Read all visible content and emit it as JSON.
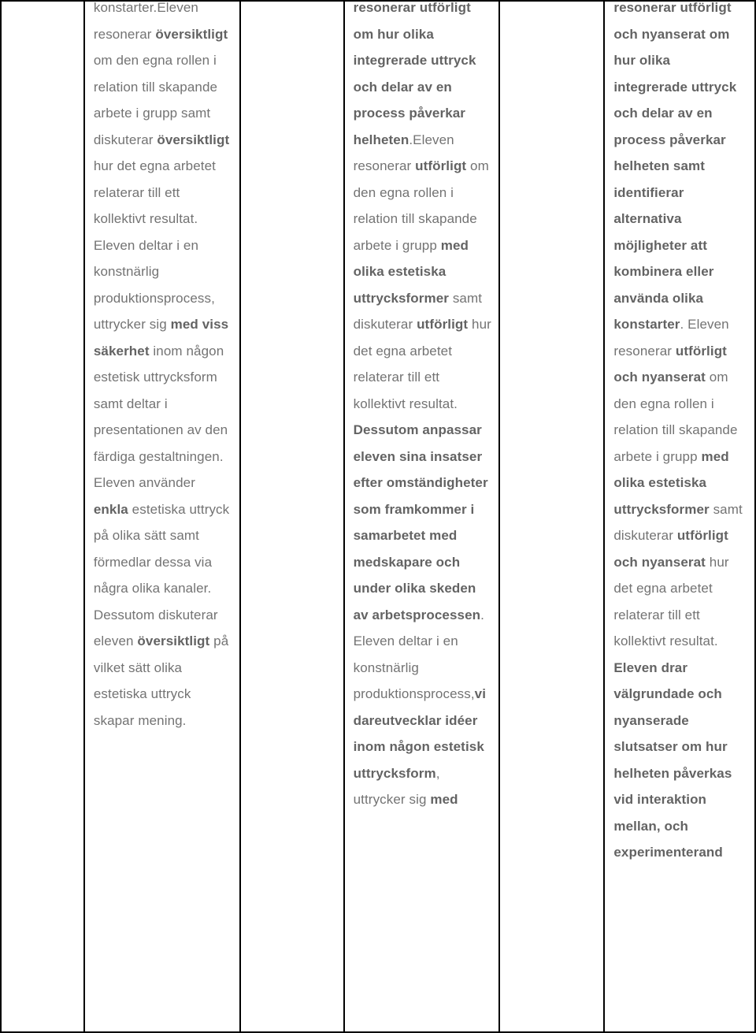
{
  "document": {
    "type": "grading-criteria-table",
    "language": "sv",
    "columns": 5,
    "text_color": "#737373",
    "bold_color": "#636363",
    "border_color": "#000000"
  },
  "table": {
    "row": {
      "pad_left_cell": "",
      "gap_cell_1": "",
      "gap_cell_2": "",
      "cells": [
        {
          "id": "criteria-column-e",
          "runs": [
            {
              "text": "konstarter.",
              "bold": false
            },
            {
              "text": "Eleven resonerar ",
              "bold": false
            },
            {
              "text": "översiktligt",
              "bold": true
            },
            {
              "text": " om den egna rollen i relation till skapande arbete i grupp samt diskuterar ",
              "bold": false
            },
            {
              "text": "översiktligt",
              "bold": true
            },
            {
              "text": " hur det egna arbetet relaterar till ett kollektivt resultat. Eleven deltar i en konstnärlig produktionsprocess, uttrycker sig ",
              "bold": false
            },
            {
              "text": "med viss säkerhet",
              "bold": true
            },
            {
              "text": " inom någon estetisk uttrycksform samt deltar i presentationen av den färdiga gestaltningen. Eleven använder ",
              "bold": false
            },
            {
              "text": "enkla",
              "bold": true
            },
            {
              "text": " estetiska uttryck på olika sätt samt förmedlar dessa via några olika kanaler. Dessutom diskuterar eleven ",
              "bold": false
            },
            {
              "text": "översiktligt",
              "bold": true
            },
            {
              "text": " på vilket sätt olika estetiska uttryck skapar mening.",
              "bold": false
            }
          ]
        },
        {
          "id": "criteria-column-c",
          "runs": [
            {
              "text": "resonerar utförligt om hur olika integrerade uttryck och delar av en process påverkar helheten",
              "bold": true
            },
            {
              "text": ".",
              "bold": false
            },
            {
              "text": "Eleven resonerar ",
              "bold": false
            },
            {
              "text": "utförligt",
              "bold": true
            },
            {
              "text": " om den egna rollen i relation till skapande arbete i grupp ",
              "bold": false
            },
            {
              "text": "med olika estetiska uttrycksformer",
              "bold": true
            },
            {
              "text": " samt diskuterar ",
              "bold": false
            },
            {
              "text": "utförligt",
              "bold": true
            },
            {
              "text": " hur det egna arbetet relaterar till ett kollektivt resultat. ",
              "bold": false
            },
            {
              "text": "Dessutom anpassar eleven sina insatser efter omständigheter som framkommer i samarbetet med medskapare och under olika skeden av arbetsprocessen",
              "bold": true
            },
            {
              "text": ". Eleven deltar i en konstnärlig produktionsprocess,",
              "bold": false
            },
            {
              "text": "vidareutvecklar idéer inom någon estetisk uttrycksform",
              "bold": true
            },
            {
              "text": ", uttrycker sig ",
              "bold": false
            },
            {
              "text": "med",
              "bold": true
            }
          ]
        },
        {
          "id": "criteria-column-a",
          "runs": [
            {
              "text": "resonerar utförligt och nyanserat om hur olika integrerade uttryck och delar av en process påverkar helheten samt identifierar alternativa möjligheter att kombinera eller använda olika konstarter",
              "bold": true
            },
            {
              "text": ". Eleven resonerar ",
              "bold": false
            },
            {
              "text": "utförligt och nyanserat",
              "bold": true
            },
            {
              "text": " om den egna rollen i relation till skapande arbete i grupp ",
              "bold": false
            },
            {
              "text": "med olika estetiska uttrycksformer",
              "bold": true
            },
            {
              "text": " samt diskuterar ",
              "bold": false
            },
            {
              "text": "utförligt och nyanserat",
              "bold": true
            },
            {
              "text": " hur det egna arbetet relaterar till ett kollektivt resultat. ",
              "bold": false
            },
            {
              "text": "Eleven drar välgrundade och nyanserade slutsatser om hur helheten påverkas vid interaktion mellan, och experimenterand",
              "bold": true
            }
          ]
        }
      ]
    }
  }
}
